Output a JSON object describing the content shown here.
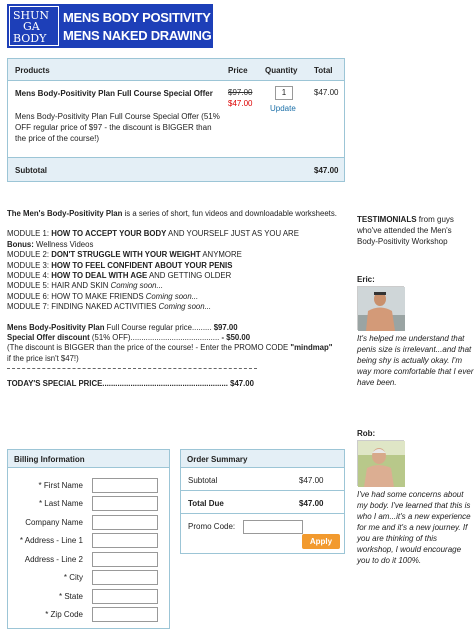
{
  "logo": {
    "letters": [
      "SHUN",
      "GA",
      "BODY"
    ],
    "line1": "MENS BODY POSITIVITY",
    "line2": "MENS NAKED DRAWING"
  },
  "cart": {
    "headers": {
      "products": "Products",
      "price": "Price",
      "quantity": "Quantity",
      "total": "Total"
    },
    "item": {
      "name": "Mens Body-Positivity Plan Full Course Special Offer",
      "description": "Mens Body-Positivity Plan Full Course Special Offer (51% OFF regular price of $97 - the discount is BIGGER than the price of the course!)",
      "old_price": "$97.00",
      "new_price": "$47.00",
      "quantity": "1",
      "update_label": "Update",
      "total": "$47.00"
    },
    "subtotal_label": "Subtotal",
    "subtotal_value": "$47.00"
  },
  "main": {
    "intro_bold": "The Men's Body-Positivity Plan",
    "intro_rest": " is a series of short, fun videos and downloadable worksheets.",
    "m1_prefix": "MODULE 1: ",
    "m1_bold": "HOW TO ACCEPT YOUR BODY",
    "m1_rest": " AND YOURSELF JUST AS YOU ARE",
    "bonus_bold": "Bonus:",
    "bonus_rest": " Wellness Videos",
    "m2_prefix": "MODULE 2: ",
    "m2_bold": "DON'T STRUGGLE WITH YOUR WEIGHT",
    "m2_rest": " ANYMORE",
    "m3_prefix": "MODULE 3: ",
    "m3_bold": "HOW TO FEEL CONFIDENT ABOUT YOUR PENIS",
    "m4_prefix": "MODULE 4: ",
    "m4_bold": "HOW TO DEAL WITH AGE",
    "m4_rest": " AND GETTING OLDER",
    "m5_text": "MODULE 5: HAIR AND SKIN ",
    "m5_italic": "Coming soon...",
    "m6_text": "MODULE 6: HOW TO MAKE FRIENDS ",
    "m6_italic": "Coming soon...",
    "m7_text": "MODULE 7: FINDING NAKED ACTIVITIES ",
    "m7_italic": "Coming soon...",
    "regular_bold": "Mens Body-Positivity Plan",
    "regular_rest": " Full Course regular price......... ",
    "regular_price": "$97.00",
    "special_bold": "Special Offer discount",
    "special_rest": " (51% OFF)......................................... ",
    "special_price": "- $50.00",
    "discount_note": "(The discount is BIGGER than the price of the course! - Enter the PROMO CODE ",
    "promo_code": "\"mindmap\"",
    "discount_note_end": " if the price isn't $47!)",
    "todays_label": "TODAY'S SPECIAL PRICE..........................................................",
    "todays_price": " $47.00"
  },
  "billing": {
    "title": "Billing Information",
    "fields": [
      "* First Name",
      "* Last Name",
      "Company Name",
      "* Address - Line 1",
      "Address - Line 2",
      "* City",
      "* State",
      "* Zip Code"
    ]
  },
  "order": {
    "title": "Order Summary",
    "subtotal_label": "Subtotal",
    "subtotal_value": "$47.00",
    "total_label": "Total Due",
    "total_value": "$47.00",
    "promo_label": "Promo Code:",
    "apply_label": "Apply"
  },
  "testimonials": {
    "title_bold": "TESTIMONIALS",
    "title_rest": " from guys who've attended the Men's Body-Positivity Workshop",
    "eric_name": "Eric:",
    "eric_quote": "It's helped me understand that penis size is irrelevant...and that being shy is actually okay. I'm way more comfortable that I ever have been.",
    "rob_name": "Rob:",
    "rob_quote": "I've had some concerns about my body. I've learned that this is who I am...it's a new experience for me and it's a new journey. If you are thinking of this workshop, I would encourage you to do it 100%."
  },
  "colors": {
    "accent_blue": "#1d3fb8",
    "header_bg": "#e4eff6",
    "border": "#9cc5d6",
    "price_red": "#dd0000",
    "link": "#1b6fa8",
    "button": "#f29a2e"
  }
}
